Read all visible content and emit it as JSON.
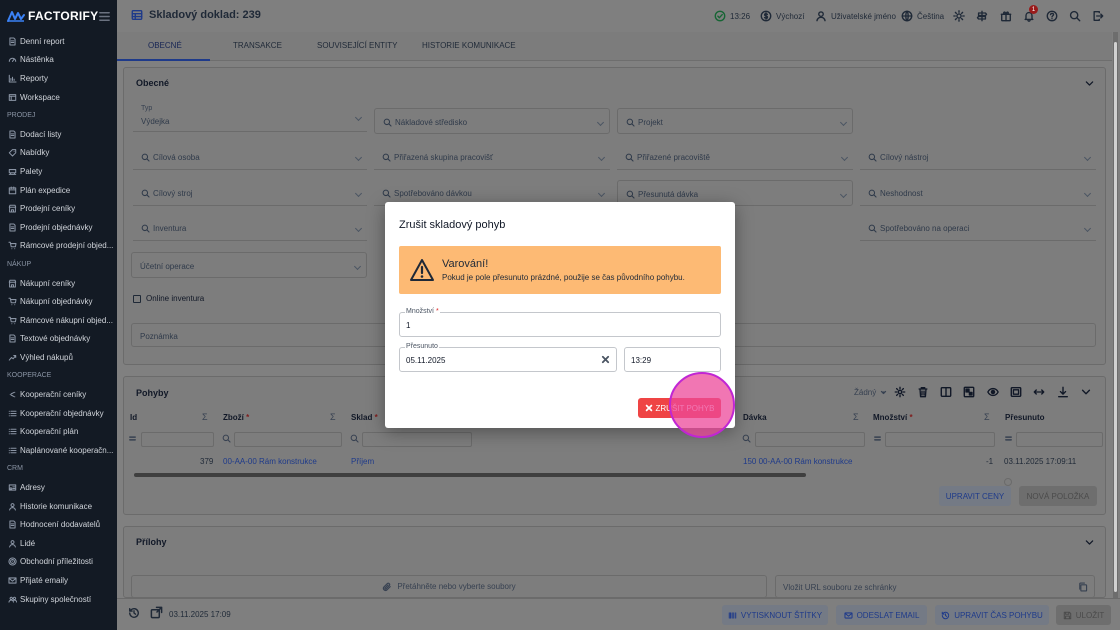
{
  "app": {
    "logo_text": "FACTORIFY"
  },
  "sidebar": {
    "items": [
      {
        "type": "item",
        "label": "Denní report",
        "icon": "report-icon"
      },
      {
        "type": "item",
        "label": "Nástěnka",
        "icon": "dashboard-icon"
      },
      {
        "type": "item",
        "label": "Reporty",
        "icon": "chart-icon"
      },
      {
        "type": "item",
        "label": "Workspace",
        "icon": "workspace-icon"
      },
      {
        "type": "section",
        "label": "PRODEJ"
      },
      {
        "type": "item",
        "label": "Dodací listy",
        "icon": "document-icon"
      },
      {
        "type": "item",
        "label": "Nabídky",
        "icon": "offer-icon"
      },
      {
        "type": "item",
        "label": "Palety",
        "icon": "pallet-icon"
      },
      {
        "type": "item",
        "label": "Plán expedice",
        "icon": "calendar-icon"
      },
      {
        "type": "item",
        "label": "Prodejní ceníky",
        "icon": "store-icon"
      },
      {
        "type": "item",
        "label": "Prodejní objednávky",
        "icon": "document-icon"
      },
      {
        "type": "item",
        "label": "Rámcové prodejní objed...",
        "icon": "cart-icon"
      },
      {
        "type": "section",
        "label": "NÁKUP"
      },
      {
        "type": "item",
        "label": "Nákupní ceníky",
        "icon": "store-icon"
      },
      {
        "type": "item",
        "label": "Nákupní objednávky",
        "icon": "cart-icon"
      },
      {
        "type": "item",
        "label": "Rámcové nákupní objed...",
        "icon": "cart-icon"
      },
      {
        "type": "item",
        "label": "Textové objednávky",
        "icon": "document-icon"
      },
      {
        "type": "item",
        "label": "Výhled nákupů",
        "icon": "trend-icon"
      },
      {
        "type": "section",
        "label": "KOOPERACE"
      },
      {
        "type": "item",
        "label": "Kooperační ceníky",
        "icon": "share-icon"
      },
      {
        "type": "item",
        "label": "Kooperační objednávky",
        "icon": "list-icon"
      },
      {
        "type": "item",
        "label": "Kooperační plán",
        "icon": "list-icon"
      },
      {
        "type": "item",
        "label": "Naplánované kooperačn...",
        "icon": "list-icon"
      },
      {
        "type": "section",
        "label": "CRM"
      },
      {
        "type": "item",
        "label": "Adresy",
        "icon": "address-icon"
      },
      {
        "type": "item",
        "label": "Historie komunikace",
        "icon": "person-icon"
      },
      {
        "type": "item",
        "label": "Hodnocení dodavatelů",
        "icon": "document-icon"
      },
      {
        "type": "item",
        "label": "Lidé",
        "icon": "person-icon"
      },
      {
        "type": "item",
        "label": "Obchodní příležitosti",
        "icon": "opportunity-icon"
      },
      {
        "type": "item",
        "label": "Přijaté emaily",
        "icon": "mail-icon"
      },
      {
        "type": "item",
        "label": "Skupiny společností",
        "icon": "group-icon"
      }
    ]
  },
  "header": {
    "title": "Skladový doklad: 239",
    "time": "13:26",
    "default_label": "Výchozí",
    "user_label": "Uživatelské jméno",
    "language": "Čeština",
    "notification_count": "1"
  },
  "tabs": [
    "OBECNÉ",
    "TRANSAKCE",
    "SOUVISEJÍCÍ ENTITY",
    "HISTORIE KOMUNIKACE"
  ],
  "general": {
    "title": "Obecné",
    "type_label": "Typ",
    "type_value": "Výdejka",
    "cost_center": "Nákladové středisko",
    "project": "Projekt",
    "target_person": "Cílová osoba",
    "assigned_group": "Přiřazená skupina pracovišť",
    "assigned_workplace": "Přiřazené pracoviště",
    "target_tool": "Cílový nástroj",
    "target_machine": "Cílový stroj",
    "consumed_batch": "Spotřebováno dávkou",
    "moved_batch": "Přesunutá dávka",
    "nonconformity": "Neshodnost",
    "inventory": "Inventura",
    "consumed_operation": "Spotřebováno na operaci",
    "accounting_operation": "Účetní operace",
    "online_inventory": "Online inventura",
    "note": "Poznámka"
  },
  "movements": {
    "title": "Pohyby",
    "view_select": "Žádný",
    "columns": {
      "id": "Id",
      "item": "Zboží",
      "warehouse": "Sklad",
      "batch": "Dávka",
      "quantity": "Množství",
      "moved": "Přesunuto",
      "sum": "Σ",
      "req": "*"
    },
    "row": {
      "id": "379",
      "item": "00-AA-00 Rám konstrukce",
      "warehouse": "Příjem",
      "batch": "150 00-AA-00 Rám konstrukce",
      "quantity": "-1",
      "moved": "03.11.2025 17:09:11"
    },
    "update_prices": "UPRAVIT CENY",
    "new_item": "NOVÁ POLOŽKA"
  },
  "attachments": {
    "title": "Přílohy",
    "drop_text": "Přetáhněte nebo vyberte soubory",
    "url_placeholder": "Vložit URL souboru ze schránky"
  },
  "footer": {
    "timestamp": "03.11.2025 17:09",
    "print_labels": "VYTISKNOUT ŠTÍTKY",
    "send_email": "ODESLAT EMAIL",
    "edit_time": "UPRAVIT ČAS POHYBU",
    "save": "ULOŽIT"
  },
  "dialog": {
    "title": "Zrušit skladový pohyb",
    "warning_title": "Varování!",
    "warning_text": "Pokud je pole přesunuto prázdné, použije se čas původního pohybu.",
    "quantity_label": "Množství",
    "quantity_required": "*",
    "quantity_value": "1",
    "moved_label": "Přesunuto",
    "moved_date": "05.11.2025",
    "moved_time": "13:29",
    "cancel_button": "ZRUŠIT POHYB"
  },
  "colors": {
    "accent": "#1e3a8a",
    "danger": "#ef4444",
    "warning_bg": "#fdba74",
    "sidebar_bg": "#131a24"
  }
}
